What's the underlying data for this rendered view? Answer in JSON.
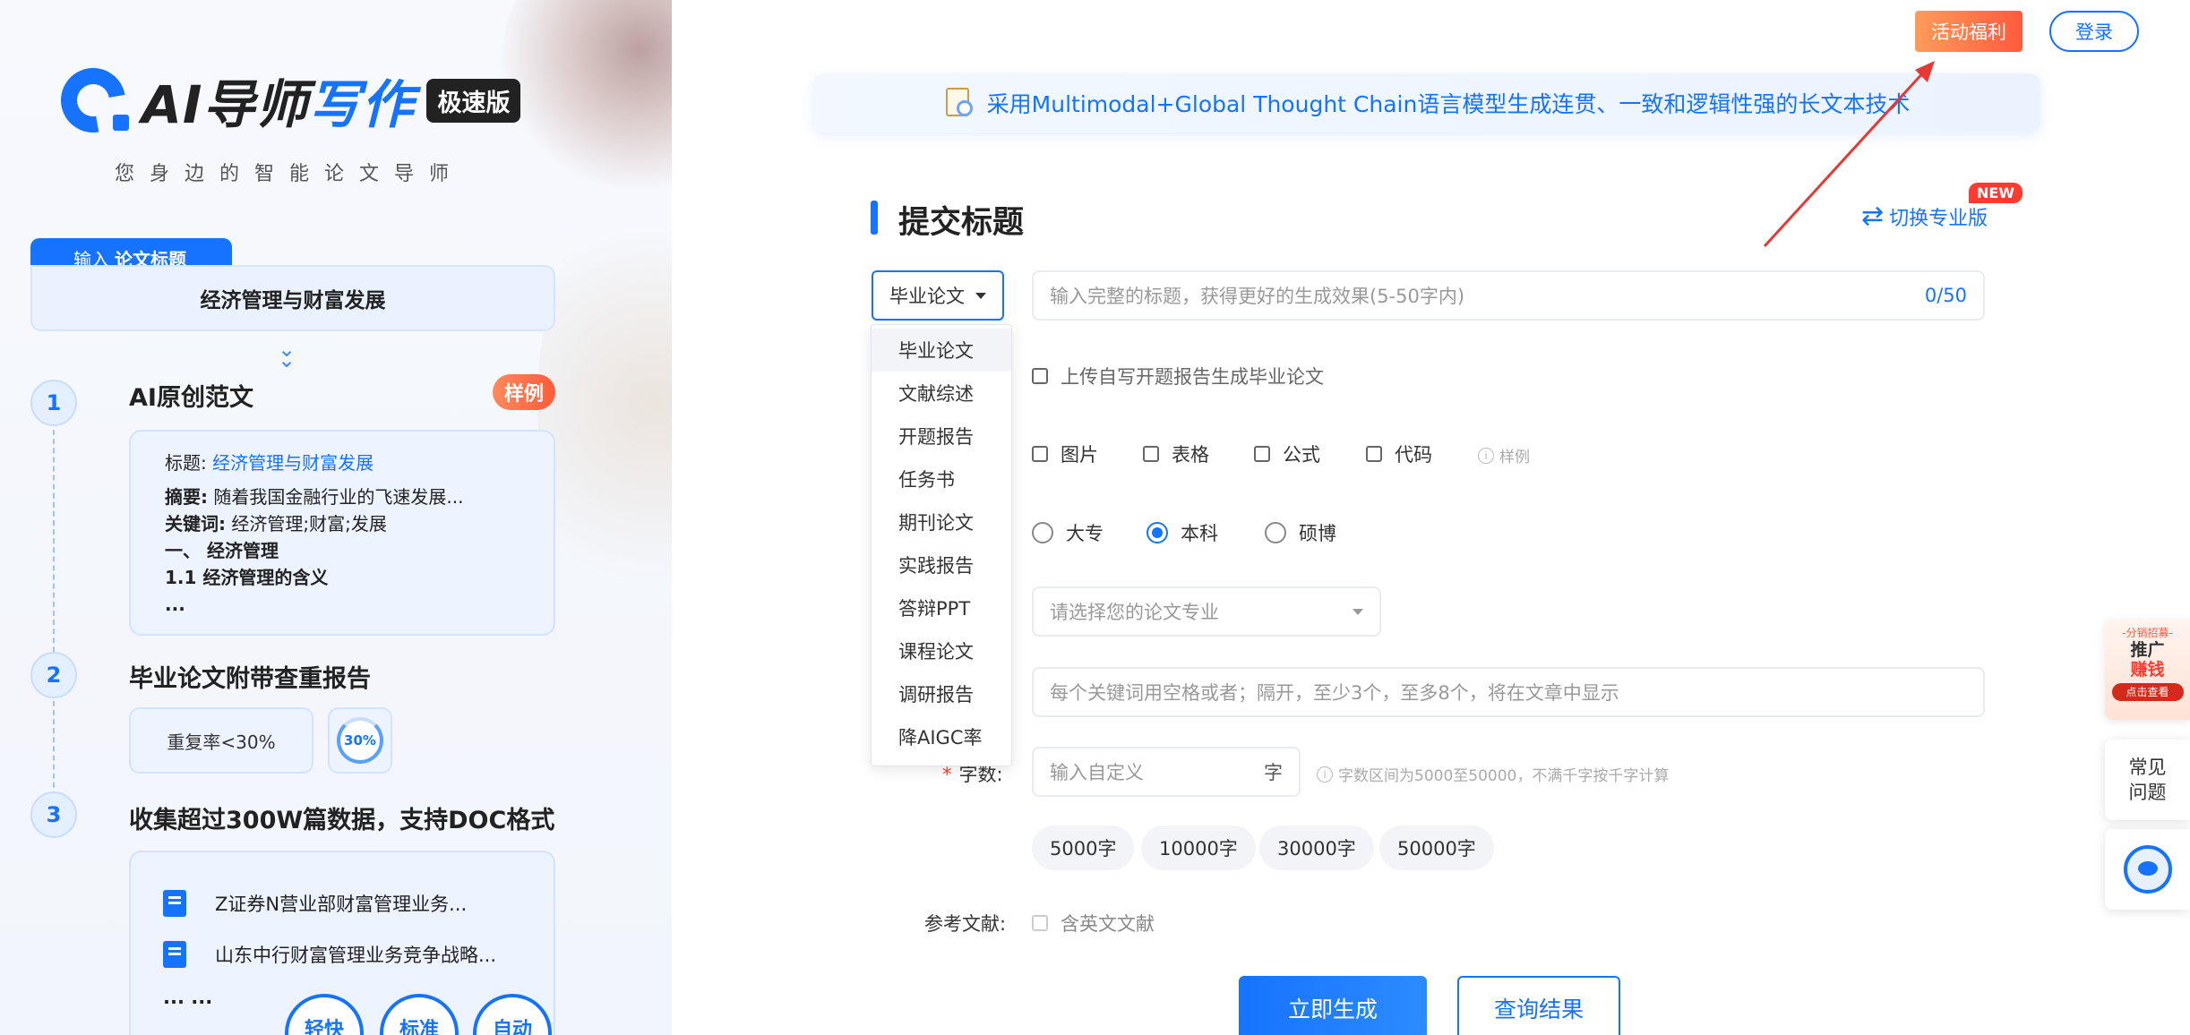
{
  "left": {
    "logo": {
      "text_a": "AI导师",
      "text_b": "写作",
      "badge": "极速版"
    },
    "slogan": "您身边的智能论文导师",
    "input_tab": {
      "prefix": "输入",
      "label": "论文标题"
    },
    "input_value": "经济管理与财富发展",
    "steps": [
      {
        "num": "1",
        "title": "AI原创范文",
        "badge": "样例"
      },
      {
        "num": "2",
        "title": "毕业论文附带查重报告"
      },
      {
        "num": "3",
        "title": "收集超过300W篇数据，支持DOC格式"
      }
    ],
    "sample": {
      "title_label": "标题:",
      "title_value": "经济管理与财富发展",
      "abstract_label": "摘要:",
      "abstract_value": "随着我国金融行业的飞速发展...",
      "keywords_label": "关键词:",
      "keywords_value": "经济管理;财富;发展",
      "h1": "一、 经济管理",
      "h2": "1.1 经济管理的含义",
      "more": "..."
    },
    "report": {
      "rate_text": "重复率<30%",
      "ring_text": "30%",
      "ring_percent": 30
    },
    "docs": [
      "Z证券N营业部财富管理业务...",
      "山东中行财富管理业务竞争战略..."
    ],
    "docs_more": "... ...",
    "pills": [
      "轻快",
      "标准",
      "自动"
    ]
  },
  "header": {
    "welfare": "活动福利",
    "login": "登录"
  },
  "banner": {
    "text": "采用Multimodal+Global Thought Chain语言模型生成连贯、一致和逻辑性强的长文本技术"
  },
  "form": {
    "section_title": "提交标题",
    "switch_label": "切换专业版",
    "new_badge": "NEW",
    "type_selected": "毕业论文",
    "title_placeholder": "输入完整的标题，获得更好的生成效果(5-50字内)",
    "title_count": "0/50",
    "type_options": [
      "毕业论文",
      "文献综述",
      "开题报告",
      "任务书",
      "期刊论文",
      "实践报告",
      "答辩PPT",
      "课程论文",
      "调研报告",
      "降AIGC率"
    ],
    "upload_label": "上传自写开题报告生成毕业论文",
    "extras": [
      "图片",
      "表格",
      "公式",
      "代码"
    ],
    "extras_hint": "样例",
    "levels": [
      "大专",
      "本科",
      "硕博"
    ],
    "level_selected": "本科",
    "major_placeholder": "请选择您的论文专业",
    "keywords_placeholder": "每个关键词用空格或者；隔开，至少3个，至多8个，将在文章中显示",
    "wordcount_label": "字数:",
    "wordcount_placeholder": "输入自定义",
    "wordcount_unit": "字",
    "wordcount_hint": "字数区间为5000至50000，不满千字按千字计算",
    "wordcount_tags": [
      "5000字",
      "10000字",
      "30000字",
      "50000字"
    ],
    "ref_label": "参考文献:",
    "ref_option": "含英文文献",
    "generate": "立即生成",
    "query": "查询结果"
  },
  "side": {
    "promo": {
      "top": "-分销招募-",
      "line1": "推广",
      "line2": "赚钱",
      "cta": "点击查看"
    },
    "faq": "常见问题"
  },
  "colors": {
    "accent": "#1673ff",
    "warm": "#ff5a3c",
    "annotation_arrow": "#e53935"
  }
}
